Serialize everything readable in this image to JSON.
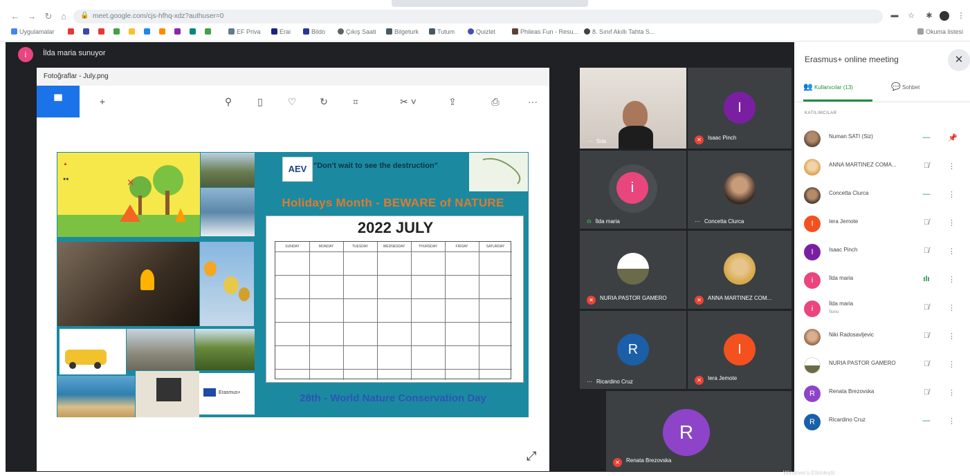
{
  "browser": {
    "url": "meet.google.com/cjs-hfhq-xdz?authuser=0",
    "bookmarks": [
      "Uygulamalar",
      "EF Priva",
      "Erai",
      "Bildo",
      "Çıkış Saati",
      "Bilgeturk",
      "Tutum",
      "Quizlet",
      "Phileas Fun - Resu...",
      "8. Sınıf Akıllı Tahta S..."
    ],
    "reading_list": "Okuma listesi"
  },
  "meet": {
    "presenter_initial": "i",
    "presenter_text": "İlda maria sunuyor",
    "presented_window_title": "Fotoğraflar - July.png",
    "poster": {
      "logo": "AEV",
      "quote": "\"Don't wait to see the destruction\"",
      "headline": "Holidays Month - BEWARE of NATURE",
      "calendar_title": "2022 JULY",
      "day_names": [
        "SUNDAY",
        "MONDAY",
        "TUESDAY",
        "WEDNESDAY",
        "THURSDAY",
        "FRIDAY",
        "SATURDAY"
      ],
      "footer": "28th - World Nature Conservation Day",
      "erasmus_label": "Erasmus+"
    },
    "tiles": [
      {
        "name": "Sıla",
        "status": "dots"
      },
      {
        "name": "Isaac Pinch",
        "initial": "I",
        "color": "#7b1fa2",
        "status": "muted"
      },
      {
        "name": "İlda maria",
        "initial": "i",
        "color": "#e8467c",
        "status": "speaking"
      },
      {
        "name": "Concetta Clurca",
        "status": "dots"
      },
      {
        "name": "NURIA PASTOR GAMERO",
        "status": "muted"
      },
      {
        "name": "ANNA MARTINEZ COM...",
        "status": "muted"
      },
      {
        "name": "Ricardino Cruz",
        "initial": "R",
        "color": "#1a5fa8",
        "status": "dots"
      },
      {
        "name": "Iera Jemote",
        "initial": "I",
        "color": "#f4511e",
        "status": "muted"
      },
      {
        "name": "Renata Brezovska",
        "initial": "R",
        "color": "#8e44c9",
        "status": "muted"
      }
    ]
  },
  "panel": {
    "title": "Erasmus+ online meeting",
    "tab_people": "Kullanıcılar (13)",
    "tab_chat": "Sohbet",
    "section_label": "KATILIMCILAR",
    "participants": [
      {
        "name": "Numan SATI (Siz)",
        "mic": "active",
        "extra": "pin"
      },
      {
        "name": "ANNA MARTINEZ COMA...",
        "mic": "muted"
      },
      {
        "name": "Concetta Clurca",
        "mic": "active"
      },
      {
        "name": "Iera Jemote",
        "mic": "muted",
        "initial": "I",
        "color": "#f4511e"
      },
      {
        "name": "Isaac Pinch",
        "mic": "muted",
        "initial": "I",
        "color": "#7b1fa2"
      },
      {
        "name": "İlda maria",
        "mic": "speaking",
        "initial": "i",
        "color": "#e8467c"
      },
      {
        "name": "İlda maria",
        "sub": "Sunu",
        "mic": "muted",
        "initial": "i",
        "color": "#e8467c"
      },
      {
        "name": "Niki Radosavljevic",
        "mic": "muted"
      },
      {
        "name": "NURIA PASTOR GAMERO",
        "mic": "muted"
      },
      {
        "name": "Renata Brezovska",
        "mic": "muted",
        "initial": "R",
        "color": "#8e44c9"
      },
      {
        "name": "Ricardino Cruz",
        "mic": "active",
        "initial": "R",
        "color": "#1a5fa8"
      }
    ]
  },
  "watermark": "Windows'u Etkinleştir"
}
